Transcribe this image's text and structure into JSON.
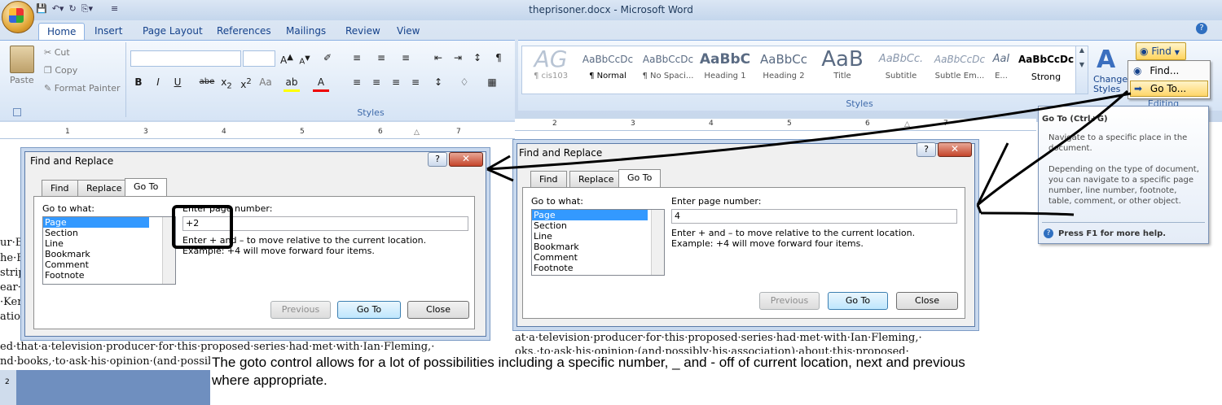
{
  "window": {
    "title": "theprisoner.docx - Microsoft Word"
  },
  "tabs": [
    "Home",
    "Insert",
    "Page Layout",
    "References",
    "Mailings",
    "Review",
    "View"
  ],
  "clipboard": {
    "paste": "Paste",
    "cut": "Cut",
    "copy": "Copy",
    "format_painter": "Format Painter"
  },
  "groups": {
    "styles": "Styles",
    "editing": "Editing"
  },
  "styles_gallery": [
    {
      "preview": "AG",
      "label": "¶ cis103"
    },
    {
      "preview": "AaBbCcDc",
      "label": "¶ Normal"
    },
    {
      "preview": "AaBbCcDc",
      "label": "¶ No Spaci..."
    },
    {
      "preview": "AaBbC",
      "label": "Heading 1"
    },
    {
      "preview": "AaBbCc",
      "label": "Heading 2"
    },
    {
      "preview": "AaB",
      "label": "Title"
    },
    {
      "preview": "AaBbCc.",
      "label": "Subtitle"
    },
    {
      "preview": "AaBbCcDc",
      "label": "Subtle Em..."
    },
    {
      "preview": "AaI",
      "label": "E..."
    },
    {
      "preview": "AaBbCcDc",
      "label": "Strong"
    }
  ],
  "change_styles": "Change Styles",
  "find_menu": {
    "button": "Find",
    "items": [
      "Find...",
      "Go To..."
    ]
  },
  "tooltip": {
    "title": "Go To (Ctrl+G)",
    "line1": "Navigate to a specific place in the document.",
    "line2": "Depending on the type of document, you can navigate to a specific page number, line number, footnote, table, comment, or other object.",
    "help": "Press F1 for more help."
  },
  "dialog": {
    "title": "Find and Replace",
    "tabs": [
      "Find",
      "Replace",
      "Go To"
    ],
    "goto_what_label": "Go to what:",
    "goto_items": [
      "Page",
      "Section",
      "Line",
      "Bookmark",
      "Comment",
      "Footnote"
    ],
    "enter_label": "Enter page number:",
    "hint": "Enter + and – to move relative to the current location. Example: +4 will move forward four items.",
    "buttons": {
      "previous": "Previous",
      "goto": "Go To",
      "close": "Close"
    }
  },
  "left_dialog_value": "+2",
  "right_dialog_value": "4",
  "left_doc": {
    "side_lines": [
      "ur·B",
      "he·B",
      "strip",
      "ear·c",
      "·Ken",
      "ation"
    ],
    "line1": "ed·that·a·television·producer·for·this·proposed·series·had·met·with·Ian·Fleming,·",
    "line2": "nd·books,·to·ask·his·opinion·(and·possibl"
  },
  "right_doc": {
    "line1": "at·a·television·producer·for·this·proposed·series·had·met·with·Ian·Fleming,·",
    "line2": "oks,·to·ask·his·opinion·(and·possibly·his·association)·about·this·proposed·"
  },
  "caption": "The goto control allows for a lot of possibilities including a specific number, _ and - off of current location, next and previous where appropriate."
}
